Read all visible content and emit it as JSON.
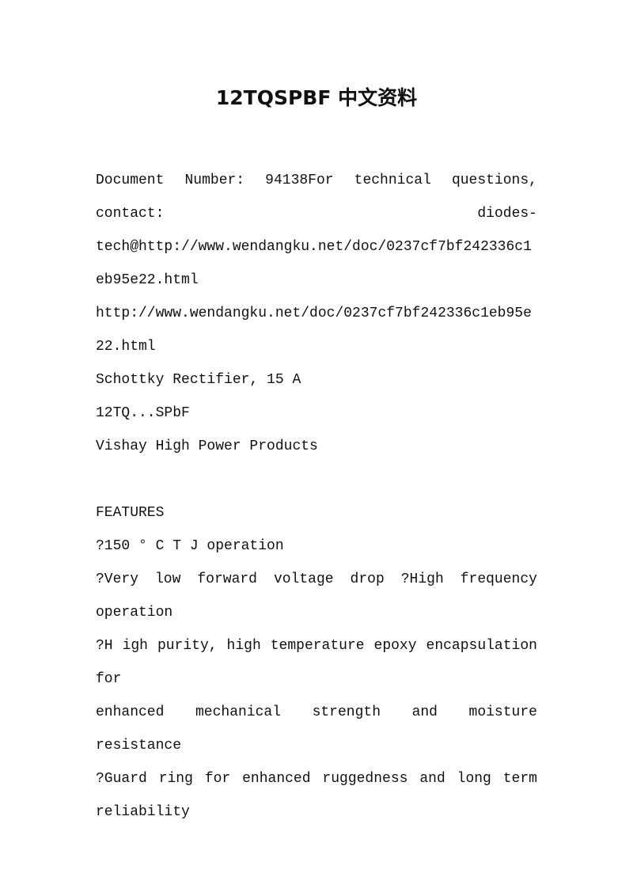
{
  "document": {
    "title": "12TQSPBF 中文资料",
    "intro_line_1_words": [
      "Document",
      "Number:",
      "94138For",
      "technical",
      "questions,"
    ],
    "intro_line_2_words": [
      "contact:",
      "diodes-"
    ],
    "intro_line_3": "tech@http://www.wendangku.net/doc/0237cf7bf242336c1",
    "intro_line_4": "eb95e22.html",
    "intro_line_5": "http://www.wendangku.net/doc/0237cf7bf242336c1eb95e",
    "intro_line_6": "22.html",
    "product_type": "Schottky Rectifier, 15 A",
    "product_series": "12TQ...SPbF",
    "manufacturer": "Vishay High Power Products",
    "features_heading": "FEATURES",
    "features": {
      "line_1": "?150 ° C T J operation",
      "line_2_words": [
        "?Very",
        "low",
        "forward",
        "voltage",
        "drop",
        "?High",
        "frequency"
      ],
      "line_3": "operation",
      "line_4_words": [
        "?H",
        "igh",
        "purity,",
        "high",
        "temperature",
        "epoxy",
        "encapsulation"
      ],
      "line_5": "for",
      "line_6_words": [
        "enhanced",
        "mechanical",
        "strength",
        "and",
        "moisture"
      ],
      "line_7": "resistance",
      "line_8_words": [
        "?Guard",
        "ring",
        "for",
        "enhanced",
        "ruggedness",
        "and",
        "long",
        "term"
      ],
      "line_9": "reliability"
    }
  }
}
